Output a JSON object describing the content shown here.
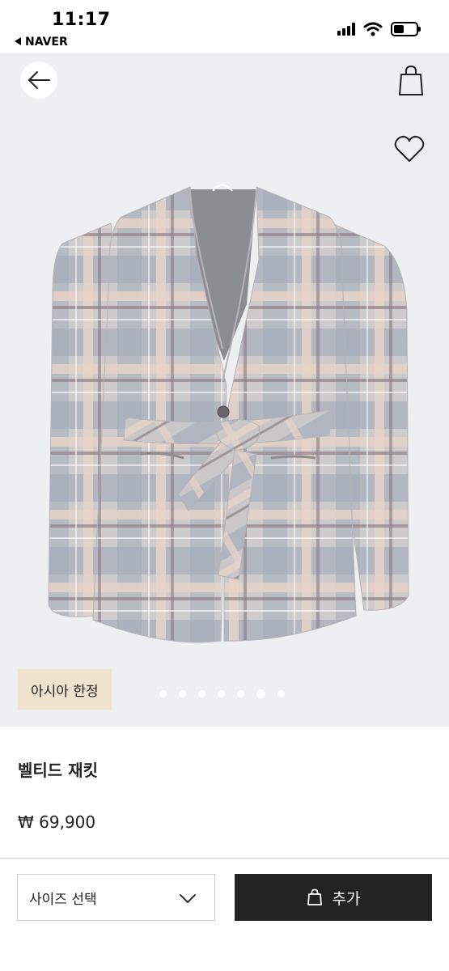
{
  "status_bar": {
    "time": "11:17",
    "back_app": "NAVER",
    "icons": [
      "cellular-signal-icon",
      "wifi-icon",
      "battery-icon"
    ]
  },
  "gallery": {
    "background": "#eeeff1",
    "badge": "아시아 한정",
    "badge_color": "#efe3cf",
    "dot_count": 7,
    "active_dot_index": 5,
    "icons": [
      "back-arrow-icon",
      "shopping-bag-icon",
      "heart-icon"
    ]
  },
  "product": {
    "name": "벨티드 재킷",
    "price": "₩ 69,900"
  },
  "bottom_bar": {
    "size_select_label": "사이즈 선택",
    "add_button_label": "추가",
    "add_button_color": "#222222",
    "icons": [
      "chevron-down-icon",
      "shopping-bag-icon"
    ]
  }
}
